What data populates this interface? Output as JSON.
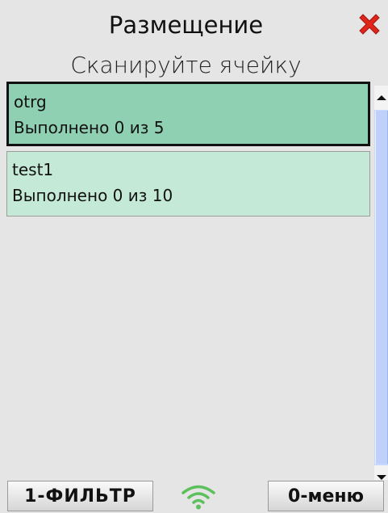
{
  "header": {
    "title": "Размещение",
    "close_icon": "close-icon",
    "subtitle": "Сканируйте ячейку"
  },
  "list": {
    "items": [
      {
        "name": "otrg",
        "status": "Выполнено 0 из 5",
        "selected": true
      },
      {
        "name": "test1",
        "status": "Выполнено 0 из 10",
        "selected": false
      }
    ]
  },
  "scrollbar": {
    "up_icon": "scroll-up-arrow-icon",
    "down_icon": "scroll-down-arrow-icon"
  },
  "footer": {
    "left_button": "1-ФИЛЬТР",
    "right_button": "0-меню",
    "status_icon": "wifi-signal-icon"
  },
  "colors": {
    "selected_item": "#8fd0b3",
    "normal_item": "#c5e9d7",
    "close": "#e0251b",
    "wifi": "#5cc05c",
    "scrollbar": "#c8d8ff"
  }
}
